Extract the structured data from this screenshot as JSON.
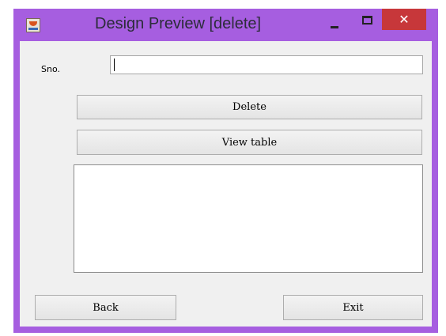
{
  "window": {
    "title": "Design Preview [delete]",
    "controls": {
      "minimize_icon": "minimize-icon",
      "maximize_icon": "maximize-icon",
      "close_glyph": "✕"
    },
    "colors": {
      "frame": "#a65ee0",
      "close": "#c7373a",
      "client": "#f0f0f0"
    }
  },
  "form": {
    "sno_label": "Sno.",
    "sno_value": "",
    "delete_label": "Delete",
    "view_table_label": "View table",
    "output_text": "",
    "back_label": "Back",
    "exit_label": "Exit"
  }
}
